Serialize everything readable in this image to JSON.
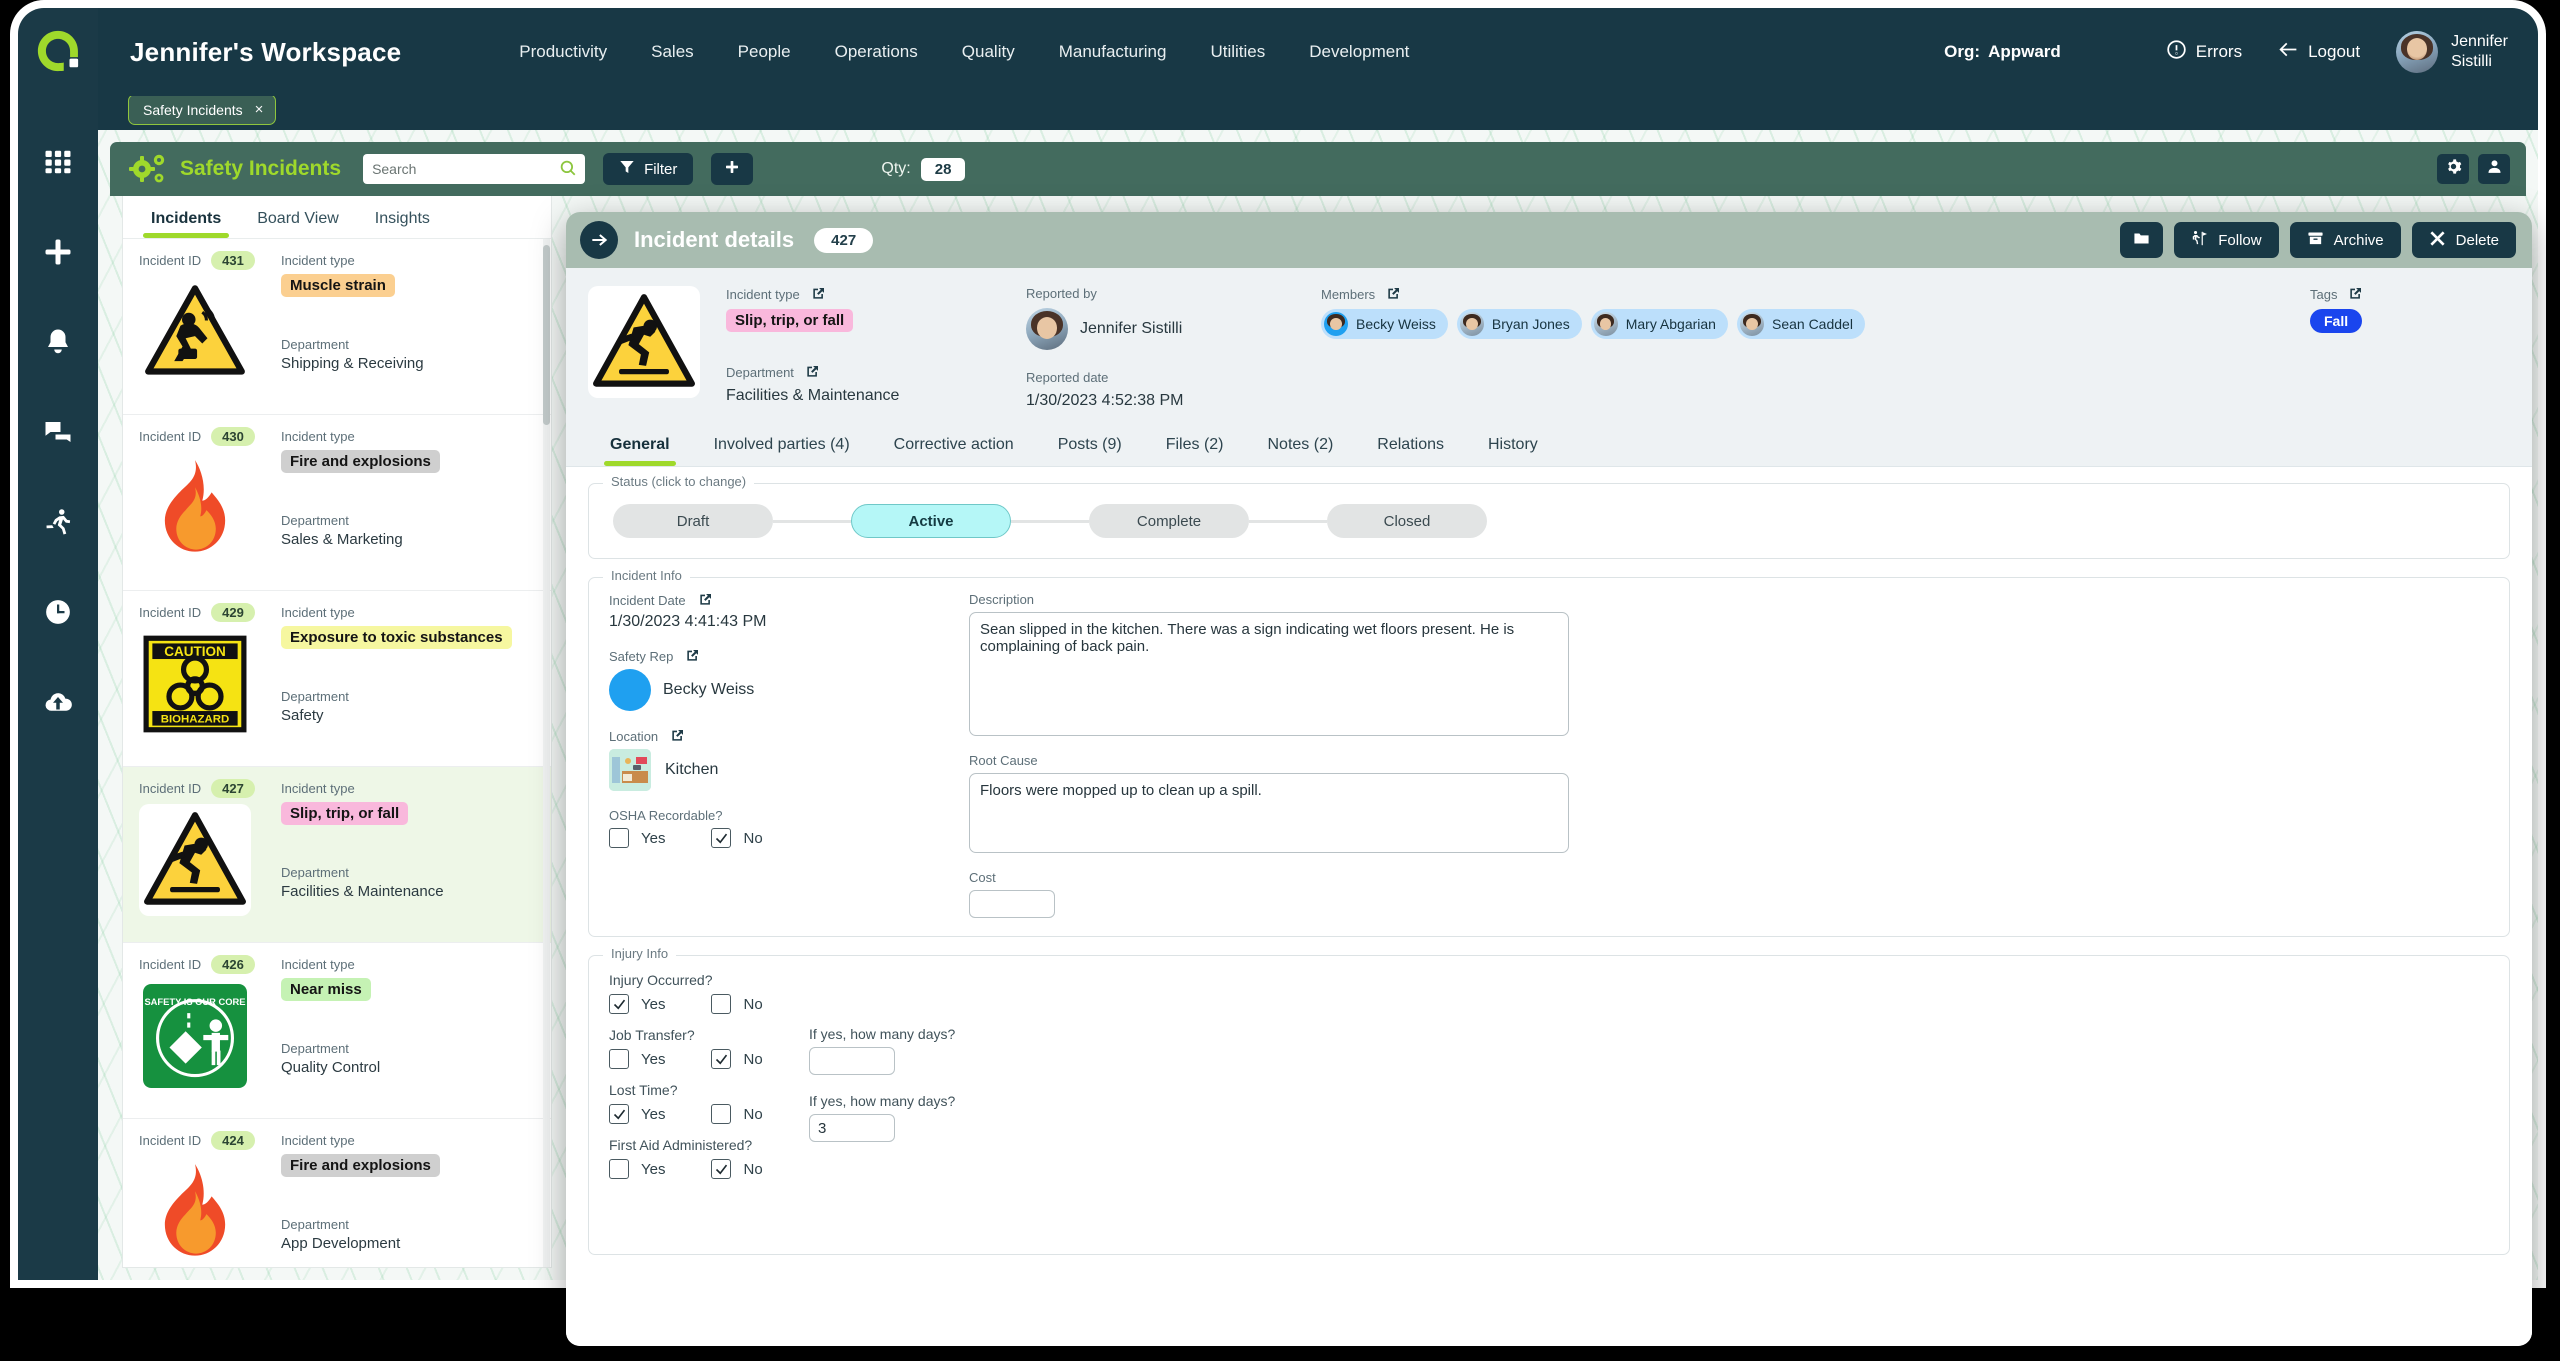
{
  "rail": {
    "logo_name": "appward-logo",
    "items": [
      {
        "name": "apps-grid-icon"
      },
      {
        "name": "plus-icon"
      },
      {
        "name": "bell-icon"
      },
      {
        "name": "chat-icon"
      },
      {
        "name": "activity-runner-icon"
      },
      {
        "name": "clock-icon"
      },
      {
        "name": "cloud-upload-icon"
      }
    ]
  },
  "topbar": {
    "workspace_title": "Jennifer's Workspace",
    "nav": [
      {
        "label": "Productivity"
      },
      {
        "label": "Sales"
      },
      {
        "label": "People"
      },
      {
        "label": "Operations"
      },
      {
        "label": "Quality"
      },
      {
        "label": "Manufacturing"
      },
      {
        "label": "Utilities"
      },
      {
        "label": "Development"
      }
    ],
    "org_label": "Org:",
    "org_value": "Appward",
    "errors_label": "Errors",
    "logout_label": "Logout",
    "user_first": "Jennifer",
    "user_last": "Sistilli"
  },
  "tabstrip": {
    "open_tab_label": "Safety Incidents",
    "close_glyph": "×"
  },
  "module_header": {
    "title": "Safety Incidents",
    "search_placeholder": "Search",
    "search_value": "",
    "filter_label": "Filter",
    "add_label": "+",
    "qty_label": "Qty:",
    "qty_value": "28"
  },
  "list": {
    "tabs": [
      {
        "label": "Incidents",
        "active": true
      },
      {
        "label": "Board View",
        "active": false
      },
      {
        "label": "Insights",
        "active": false
      }
    ],
    "id_label": "Incident ID",
    "type_label": "Incident type",
    "dept_label": "Department",
    "items": [
      {
        "id": "431",
        "type": "Muscle strain",
        "type_color": "#fbcf90",
        "department": "Shipping & Receiving",
        "icon": "muscle-strain-hazard-icon",
        "selected": false
      },
      {
        "id": "430",
        "type": "Fire and explosions",
        "type_color": "#cfcfcf",
        "department": "Sales & Marketing",
        "icon": "flame-icon",
        "selected": false
      },
      {
        "id": "429",
        "type": "Exposure to toxic substances",
        "type_color": "#f6f7a0",
        "department": "Safety",
        "icon": "biohazard-caution-icon",
        "selected": false
      },
      {
        "id": "427",
        "type": "Slip, trip, or fall",
        "type_color": "#f9b8dc",
        "department": "Facilities & Maintenance",
        "icon": "slip-trip-fall-hazard-icon",
        "selected": true
      },
      {
        "id": "426",
        "type": "Near miss",
        "type_color": "#c5f2b4",
        "department": "Quality Control",
        "icon": "safety-core-value-icon",
        "selected": false
      },
      {
        "id": "424",
        "type": "Fire and explosions",
        "type_color": "#cfcfcf",
        "department": "App Development",
        "icon": "flame-icon",
        "selected": false
      }
    ]
  },
  "detail": {
    "title": "Incident details",
    "record_id": "427",
    "actions": [
      {
        "label": "",
        "icon": "folder-icon",
        "name": "folder-button"
      },
      {
        "label": "Follow",
        "icon": "follow-icon",
        "name": "follow-button"
      },
      {
        "label": "Archive",
        "icon": "archive-icon",
        "name": "archive-button"
      },
      {
        "label": "Delete",
        "icon": "close-x-icon",
        "name": "delete-button"
      }
    ],
    "incident_type_label": "Incident type",
    "incident_type_value": "Slip, trip, or fall",
    "incident_type_color": "#f9b8dc",
    "department_label": "Department",
    "department_value": "Facilities & Maintenance",
    "reported_by_label": "Reported by",
    "reported_by_value": "Jennifer Sistilli",
    "reported_date_label": "Reported date",
    "reported_date_value": "1/30/2023 4:52:38 PM",
    "members_label": "Members",
    "members": [
      {
        "name": "Becky Weiss"
      },
      {
        "name": "Bryan Jones"
      },
      {
        "name": "Mary Abgarian"
      },
      {
        "name": "Sean Caddel"
      }
    ],
    "tags_label": "Tags",
    "tags": [
      {
        "label": "Fall",
        "color": "#1a45ee"
      }
    ],
    "tabs": [
      {
        "label": "General",
        "active": true
      },
      {
        "label": "Involved parties (4)",
        "active": false
      },
      {
        "label": "Corrective action",
        "active": false
      },
      {
        "label": "Posts (9)",
        "active": false
      },
      {
        "label": "Files (2)",
        "active": false
      },
      {
        "label": "Notes (2)",
        "active": false
      },
      {
        "label": "Relations",
        "active": false
      },
      {
        "label": "History",
        "active": false
      }
    ],
    "status": {
      "legend": "Status (click to change)",
      "steps": [
        {
          "label": "Draft",
          "active": false
        },
        {
          "label": "Active",
          "active": true
        },
        {
          "label": "Complete",
          "active": false
        },
        {
          "label": "Closed",
          "active": false
        }
      ]
    },
    "incident_info": {
      "legend": "Incident Info",
      "incident_date_label": "Incident Date",
      "incident_date_value": "1/30/2023 4:41:43 PM",
      "safety_rep_label": "Safety Rep",
      "safety_rep_value": "Becky Weiss",
      "location_label": "Location",
      "location_value": "Kitchen",
      "osha_label": "OSHA Recordable?",
      "osha_yes": "Yes",
      "osha_no": "No",
      "osha_yes_checked": false,
      "osha_no_checked": true,
      "description_label": "Description",
      "description_value": "Sean slipped in the kitchen. There was a sign indicating wet floors present. He is complaining of back pain.",
      "root_cause_label": "Root Cause",
      "root_cause_value": "Floors were mopped up to clean up a spill.",
      "cost_label": "Cost",
      "cost_value": ""
    },
    "injury_info": {
      "legend": "Injury Info",
      "yes_label": "Yes",
      "no_label": "No",
      "days_label": "If yes, how many days?",
      "rows": [
        {
          "question": "Injury Occurred?",
          "yes_checked": true,
          "no_checked": false,
          "has_days": false,
          "days_value": ""
        },
        {
          "question": "Job Transfer?",
          "yes_checked": false,
          "no_checked": true,
          "has_days": true,
          "days_value": ""
        },
        {
          "question": "Lost Time?",
          "yes_checked": true,
          "no_checked": false,
          "has_days": true,
          "days_value": "3"
        },
        {
          "question": "First Aid Administered?",
          "yes_checked": false,
          "no_checked": true,
          "has_days": false,
          "days_value": ""
        }
      ]
    }
  }
}
